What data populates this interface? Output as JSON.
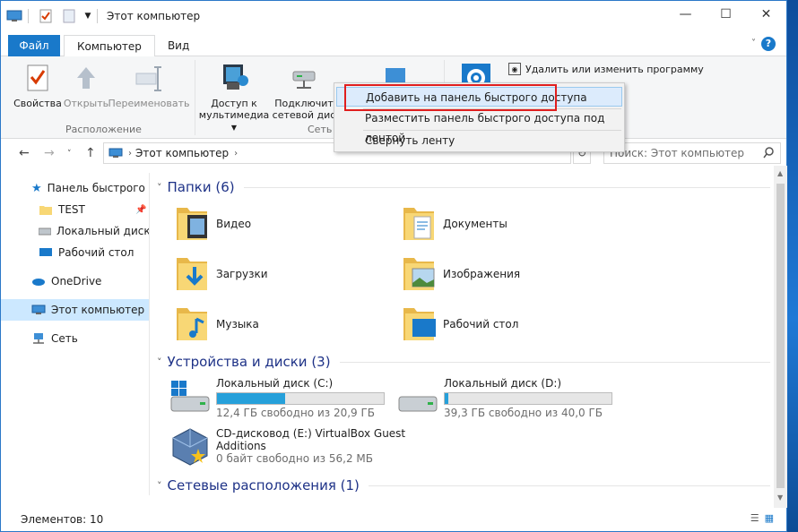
{
  "window": {
    "title": "Этот компьютер"
  },
  "tabs": {
    "file": "Файл",
    "computer": "Компьютер",
    "view": "Вид"
  },
  "ribbon": {
    "properties": "Свойства",
    "open": "Открыть",
    "rename": "Переименовать",
    "media_line1": "Доступ к",
    "media_line2": "мультимедиа",
    "map_line1": "Подключит",
    "map_line2": "сетевой дис",
    "uninstall": "Удалить или изменить программу",
    "group_location": "Расположение",
    "group_network": "Сеть"
  },
  "context_menu": {
    "add_quick_access": "Добавить на панель быстрого доступа",
    "place_below": "Разместить панель быстрого доступа под лентой",
    "minimize_ribbon": "Свернуть ленту"
  },
  "address": {
    "path": "Этот компьютер",
    "search_placeholder": "Поиск: Этот компьютер"
  },
  "nav": {
    "quick_access": "Панель быстрого дс",
    "test": "TEST",
    "local_d": "Локальный диск (D",
    "desktop": "Рабочий стол",
    "onedrive": "OneDrive",
    "this_pc": "Этот компьютер",
    "network": "Сеть"
  },
  "sections": {
    "folders": "Папки (6)",
    "devices": "Устройства и диски (3)",
    "network": "Сетевые расположения (1)"
  },
  "folders": [
    "Видео",
    "Документы",
    "Загрузки",
    "Изображения",
    "Музыка",
    "Рабочий стол"
  ],
  "drives": [
    {
      "name": "Локальный диск (C:)",
      "free": "12,4 ГБ свободно из 20,9 ГБ",
      "used_fraction": 0.41
    },
    {
      "name": "Локальный диск (D:)",
      "free": "39,3 ГБ свободно из 40,0 ГБ",
      "used_fraction": 0.02
    },
    {
      "name_line1": "CD-дисковод (E:) VirtualBox Guest",
      "name_line2": "Additions",
      "free": "0 байт свободно из 56,2 МБ"
    }
  ],
  "status": {
    "count": "Элементов: 10"
  },
  "colors": {
    "accent": "#1979ca",
    "folder": "#f8d775",
    "bar": "#26a0da",
    "highlight": "#e01e1e"
  }
}
